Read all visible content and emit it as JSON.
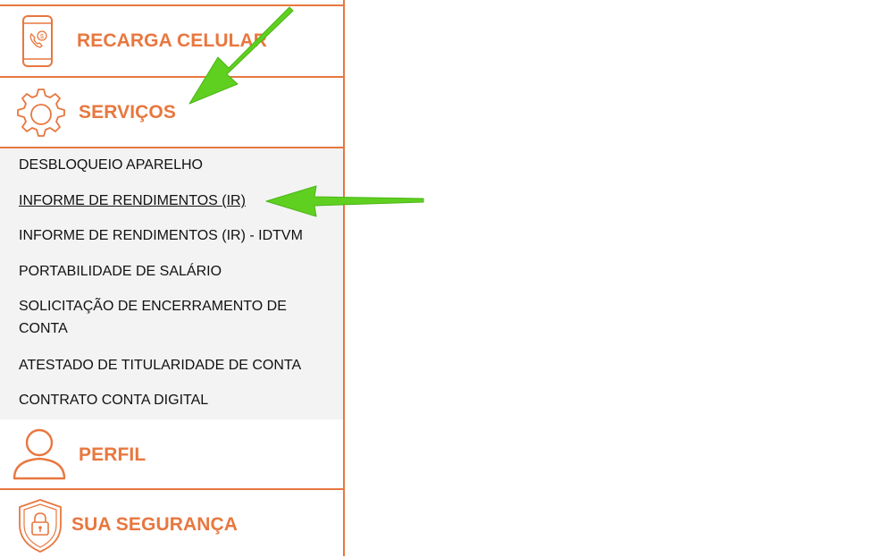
{
  "sidebar": {
    "items": [
      {
        "label": "RECARGA CELULAR",
        "icon": "phone-recharge-icon"
      },
      {
        "label": "SERVIÇOS",
        "icon": "gear-icon"
      },
      {
        "label": "PERFIL",
        "icon": "user-icon"
      },
      {
        "label": "SUA SEGURANÇA",
        "icon": "shield-lock-icon"
      }
    ],
    "submenu": [
      "DESBLOQUEIO APARELHO",
      "INFORME DE RENDIMENTOS (IR)",
      "INFORME DE RENDIMENTOS (IR) - IDTVM",
      "PORTABILIDADE DE SALÁRIO",
      "SOLICITAÇÃO DE ENCERRAMENTO DE CONTA",
      "ATESTADO DE TITULARIDADE DE CONTA",
      "CONTRATO CONTA DIGITAL"
    ]
  },
  "colors": {
    "accent": "#E8773F",
    "arrow": "#5fd020",
    "submenu_bg": "#f3f3f3"
  }
}
